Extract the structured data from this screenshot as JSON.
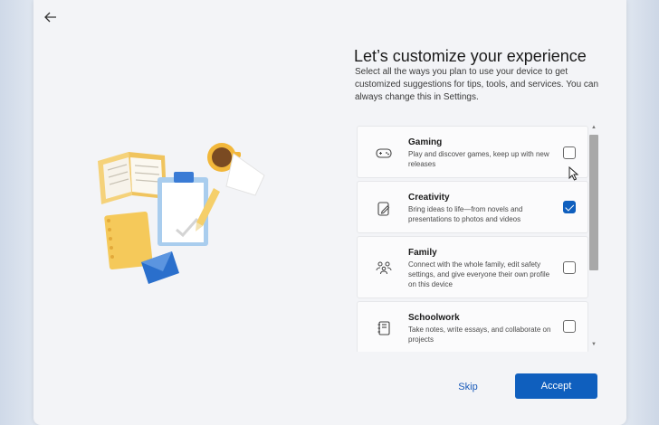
{
  "header": {
    "title": "Let’s customize your experience",
    "description": "Select all the ways you plan to use your device to get customized suggestions for tips, tools, and services. You can always change this in Settings."
  },
  "options": [
    {
      "icon": "gamepad-icon",
      "name": "Gaming",
      "description": "Play and discover games, keep up with new releases",
      "checked": false
    },
    {
      "icon": "pen-tablet-icon",
      "name": "Creativity",
      "description": "Bring ideas to life—from novels and presentations to photos and videos",
      "checked": true
    },
    {
      "icon": "people-icon",
      "name": "Family",
      "description": "Connect with the whole family, edit safety settings, and give everyone their own profile on this device",
      "checked": false
    },
    {
      "icon": "notebook-icon",
      "name": "Schoolwork",
      "description": "Take notes, write essays, and collaborate on projects",
      "checked": false
    }
  ],
  "buttons": {
    "skip": "Skip",
    "accept": "Accept"
  },
  "colors": {
    "accent": "#0f5fbe",
    "background": "#f3f4f7"
  }
}
